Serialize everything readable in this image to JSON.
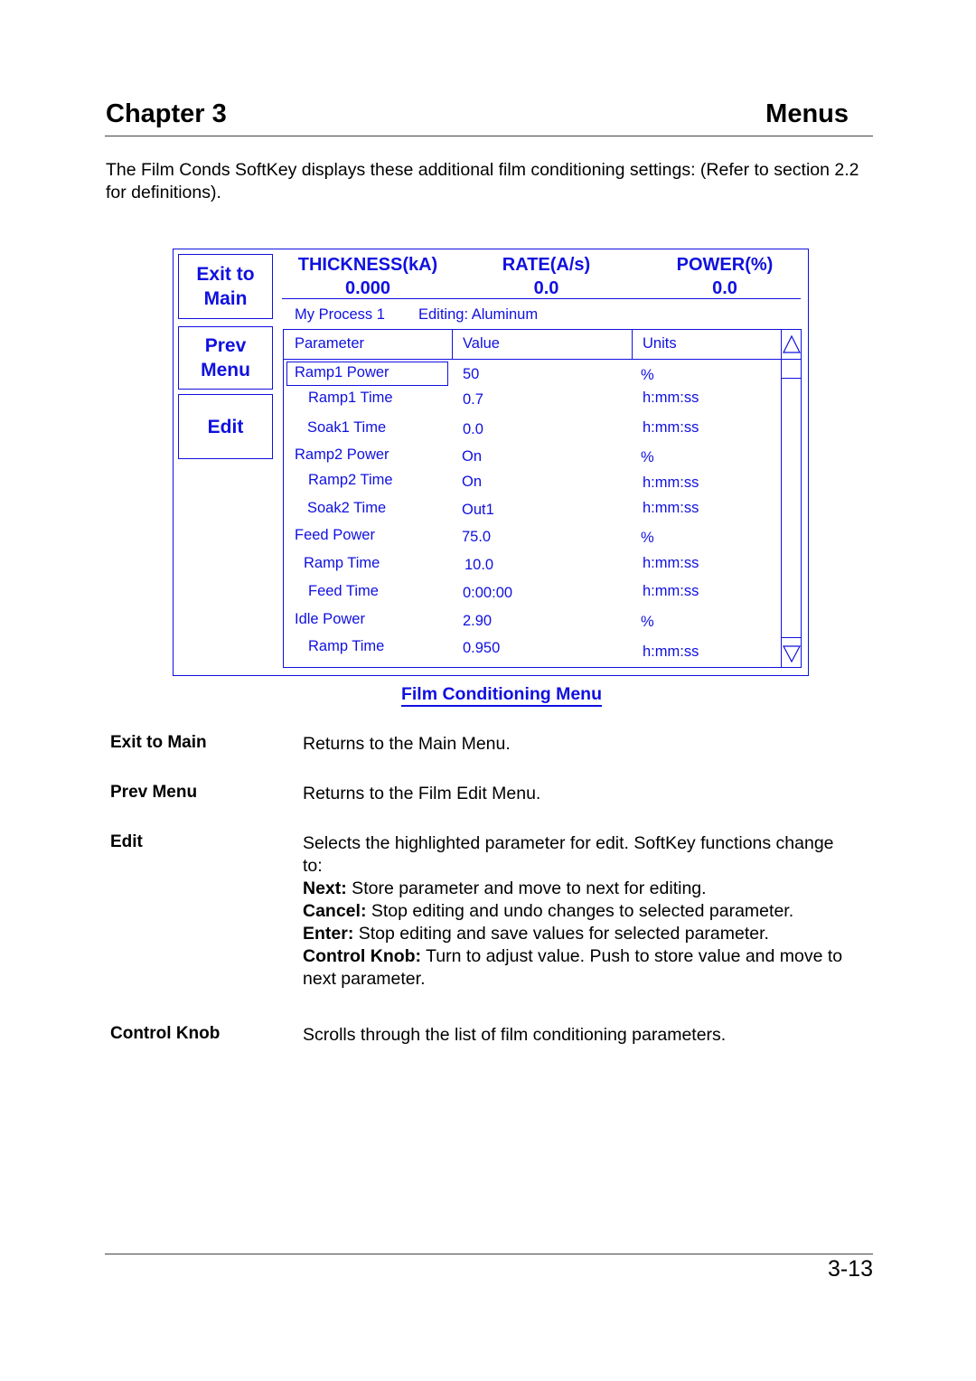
{
  "header": {
    "chapter": "Chapter 3",
    "section": "Menus"
  },
  "intro": "The Film Conds SoftKey displays these additional film conditioning settings:  (Refer to section 2.2 for definitions).",
  "screen": {
    "softkeys": [
      {
        "label": "Exit to Main"
      },
      {
        "label": "Prev Menu"
      },
      {
        "label": "Edit"
      }
    ],
    "readouts": [
      {
        "label": "THICKNESS(kA)",
        "value": "0.000"
      },
      {
        "label": "RATE(A/s)",
        "value": "0.0"
      },
      {
        "label": "POWER(%)",
        "value": "0.0"
      }
    ],
    "process_name": "My Process 1",
    "editing": "Editing: Aluminum",
    "table": {
      "columns": [
        "Parameter",
        "Value",
        "Units"
      ],
      "rows": [
        {
          "parameter": "Ramp1 Power",
          "value": "50",
          "units": "%",
          "selected": true
        },
        {
          "parameter": "Ramp1 Time",
          "value": "0.7",
          "units": "h:mm:ss"
        },
        {
          "parameter": "Soak1 Time",
          "value": "0.0",
          "units": "h:mm:ss"
        },
        {
          "parameter": "Ramp2 Power",
          "value": "On",
          "units": "%"
        },
        {
          "parameter": "Ramp2 Time",
          "value": "On",
          "units": "h:mm:ss"
        },
        {
          "parameter": "Soak2 Time",
          "value": "Out1",
          "units": "h:mm:ss"
        },
        {
          "parameter": "Feed Power",
          "value": "75.0",
          "units": "%"
        },
        {
          "parameter": "Ramp Time",
          "value": "10.0",
          "units": "h:mm:ss"
        },
        {
          "parameter": "Feed Time",
          "value": "0:00:00",
          "units": "h:mm:ss"
        },
        {
          "parameter": "Idle Power",
          "value": "2.90",
          "units": "%"
        },
        {
          "parameter": "Ramp Time",
          "value": "0.950",
          "units": "h:mm:ss"
        }
      ]
    },
    "scroll_up_icon": "triangle-up",
    "scroll_down_icon": "triangle-down"
  },
  "caption": "Film Conditioning Menu",
  "definitions": [
    {
      "term": "Exit to Main",
      "text": "Returns to the Main Menu."
    },
    {
      "term": "Prev Menu",
      "text": "Returns to the Film Edit Menu."
    },
    {
      "term": "Edit",
      "text": "Selects the highlighted parameter for edit.  SoftKey functions change to:",
      "sub": [
        {
          "key": "Next:",
          "text": " Store parameter and move to next for editing."
        },
        {
          "key": "Cancel:",
          "text": " Stop editing and undo changes to selected parameter."
        },
        {
          "key": "Enter:",
          "text": " Stop editing and save values for selected parameter."
        },
        {
          "key": "Control Knob:",
          "text": " Turn to adjust value.  Push to store value and move to next parameter."
        }
      ]
    },
    {
      "term": "Control Knob",
      "text": "Scrolls through the list of film conditioning parameters."
    }
  ],
  "page_number": "3-13",
  "colors": {
    "screen_blue": "#1010e0",
    "text": "#000000"
  }
}
